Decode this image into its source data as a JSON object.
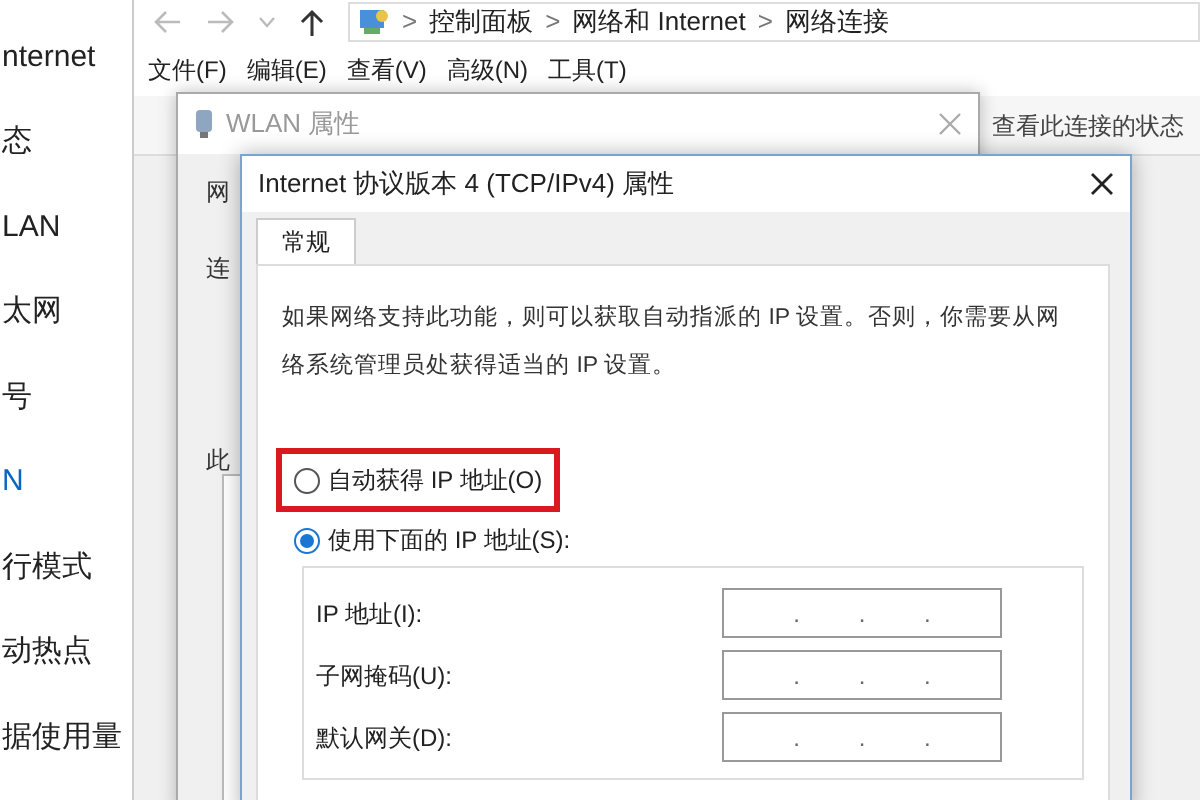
{
  "settings_sidebar": {
    "items": [
      {
        "label": "nternet",
        "selected": false
      },
      {
        "label": "态",
        "selected": false
      },
      {
        "label": "LAN",
        "selected": false
      },
      {
        "label": "太网",
        "selected": false
      },
      {
        "label": "号",
        "selected": false
      },
      {
        "label": "N",
        "selected": true
      },
      {
        "label": "行模式",
        "selected": false
      },
      {
        "label": "动热点",
        "selected": false
      },
      {
        "label": "据使用量",
        "selected": false
      }
    ]
  },
  "explorer": {
    "breadcrumbs": [
      "控制面板",
      "网络和 Internet",
      "网络连接"
    ],
    "breadcrumb_separator": ">",
    "menu": [
      "文件(F)",
      "编辑(E)",
      "查看(V)",
      "高级(N)",
      "工具(T)"
    ],
    "toolbar": [
      "查看此连接的状态"
    ]
  },
  "wlan_window": {
    "title": "WLAN 属性",
    "fragments": [
      "网",
      "连",
      "此"
    ]
  },
  "ipv4_dialog": {
    "title": "Internet 协议版本 4 (TCP/IPv4) 属性",
    "tabs": [
      {
        "label": "常规",
        "selected": true
      }
    ],
    "description": "如果网络支持此功能，则可以获取自动指派的 IP 设置。否则，你需要从网络系统管理员处获得适当的 IP 设置。",
    "radios": [
      {
        "label": "自动获得 IP 地址(O)",
        "selected": false,
        "highlighted": true
      },
      {
        "label": "使用下面的 IP 地址(S):",
        "selected": true,
        "highlighted": false
      }
    ],
    "fields": [
      {
        "label": "IP 地址(I):",
        "separator": "."
      },
      {
        "label": "子网掩码(U):",
        "separator": "."
      },
      {
        "label": "默认网关(D):",
        "separator": "."
      }
    ]
  }
}
